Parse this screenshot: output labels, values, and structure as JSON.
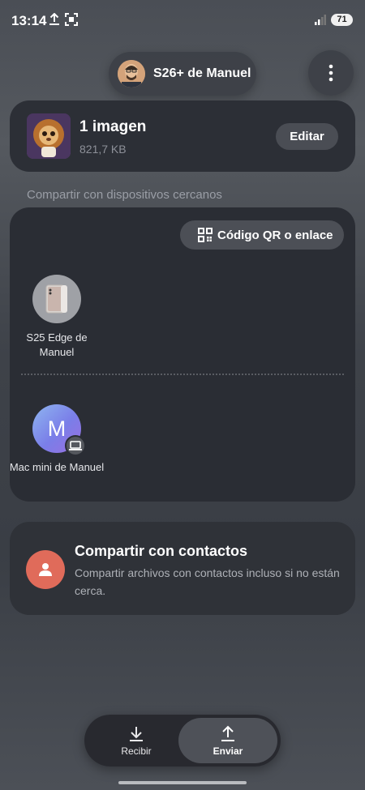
{
  "status_bar": {
    "time": "13:14",
    "battery": "71"
  },
  "header": {
    "device_name": "S26+ de Manuel"
  },
  "file": {
    "title": "1 imagen",
    "size": "821,7 KB",
    "edit_label": "Editar"
  },
  "nearby": {
    "section_label": "Compartir con dispositivos cercanos",
    "qr_label": "Código QR o enlace",
    "devices": [
      {
        "name": "S25 Edge de Manuel"
      },
      {
        "name": "Mac mini de Manuel",
        "initial": "M"
      }
    ]
  },
  "contacts": {
    "title": "Compartir con contactos",
    "description": "Compartir archivos con contactos incluso si no están cerca."
  },
  "bottom_nav": {
    "receive_label": "Recibir",
    "send_label": "Enviar",
    "active": "send"
  },
  "colors": {
    "accent_contact": "#e06b5a",
    "card_bg": "#2a2d34",
    "button_bg": "#4c4f56"
  }
}
